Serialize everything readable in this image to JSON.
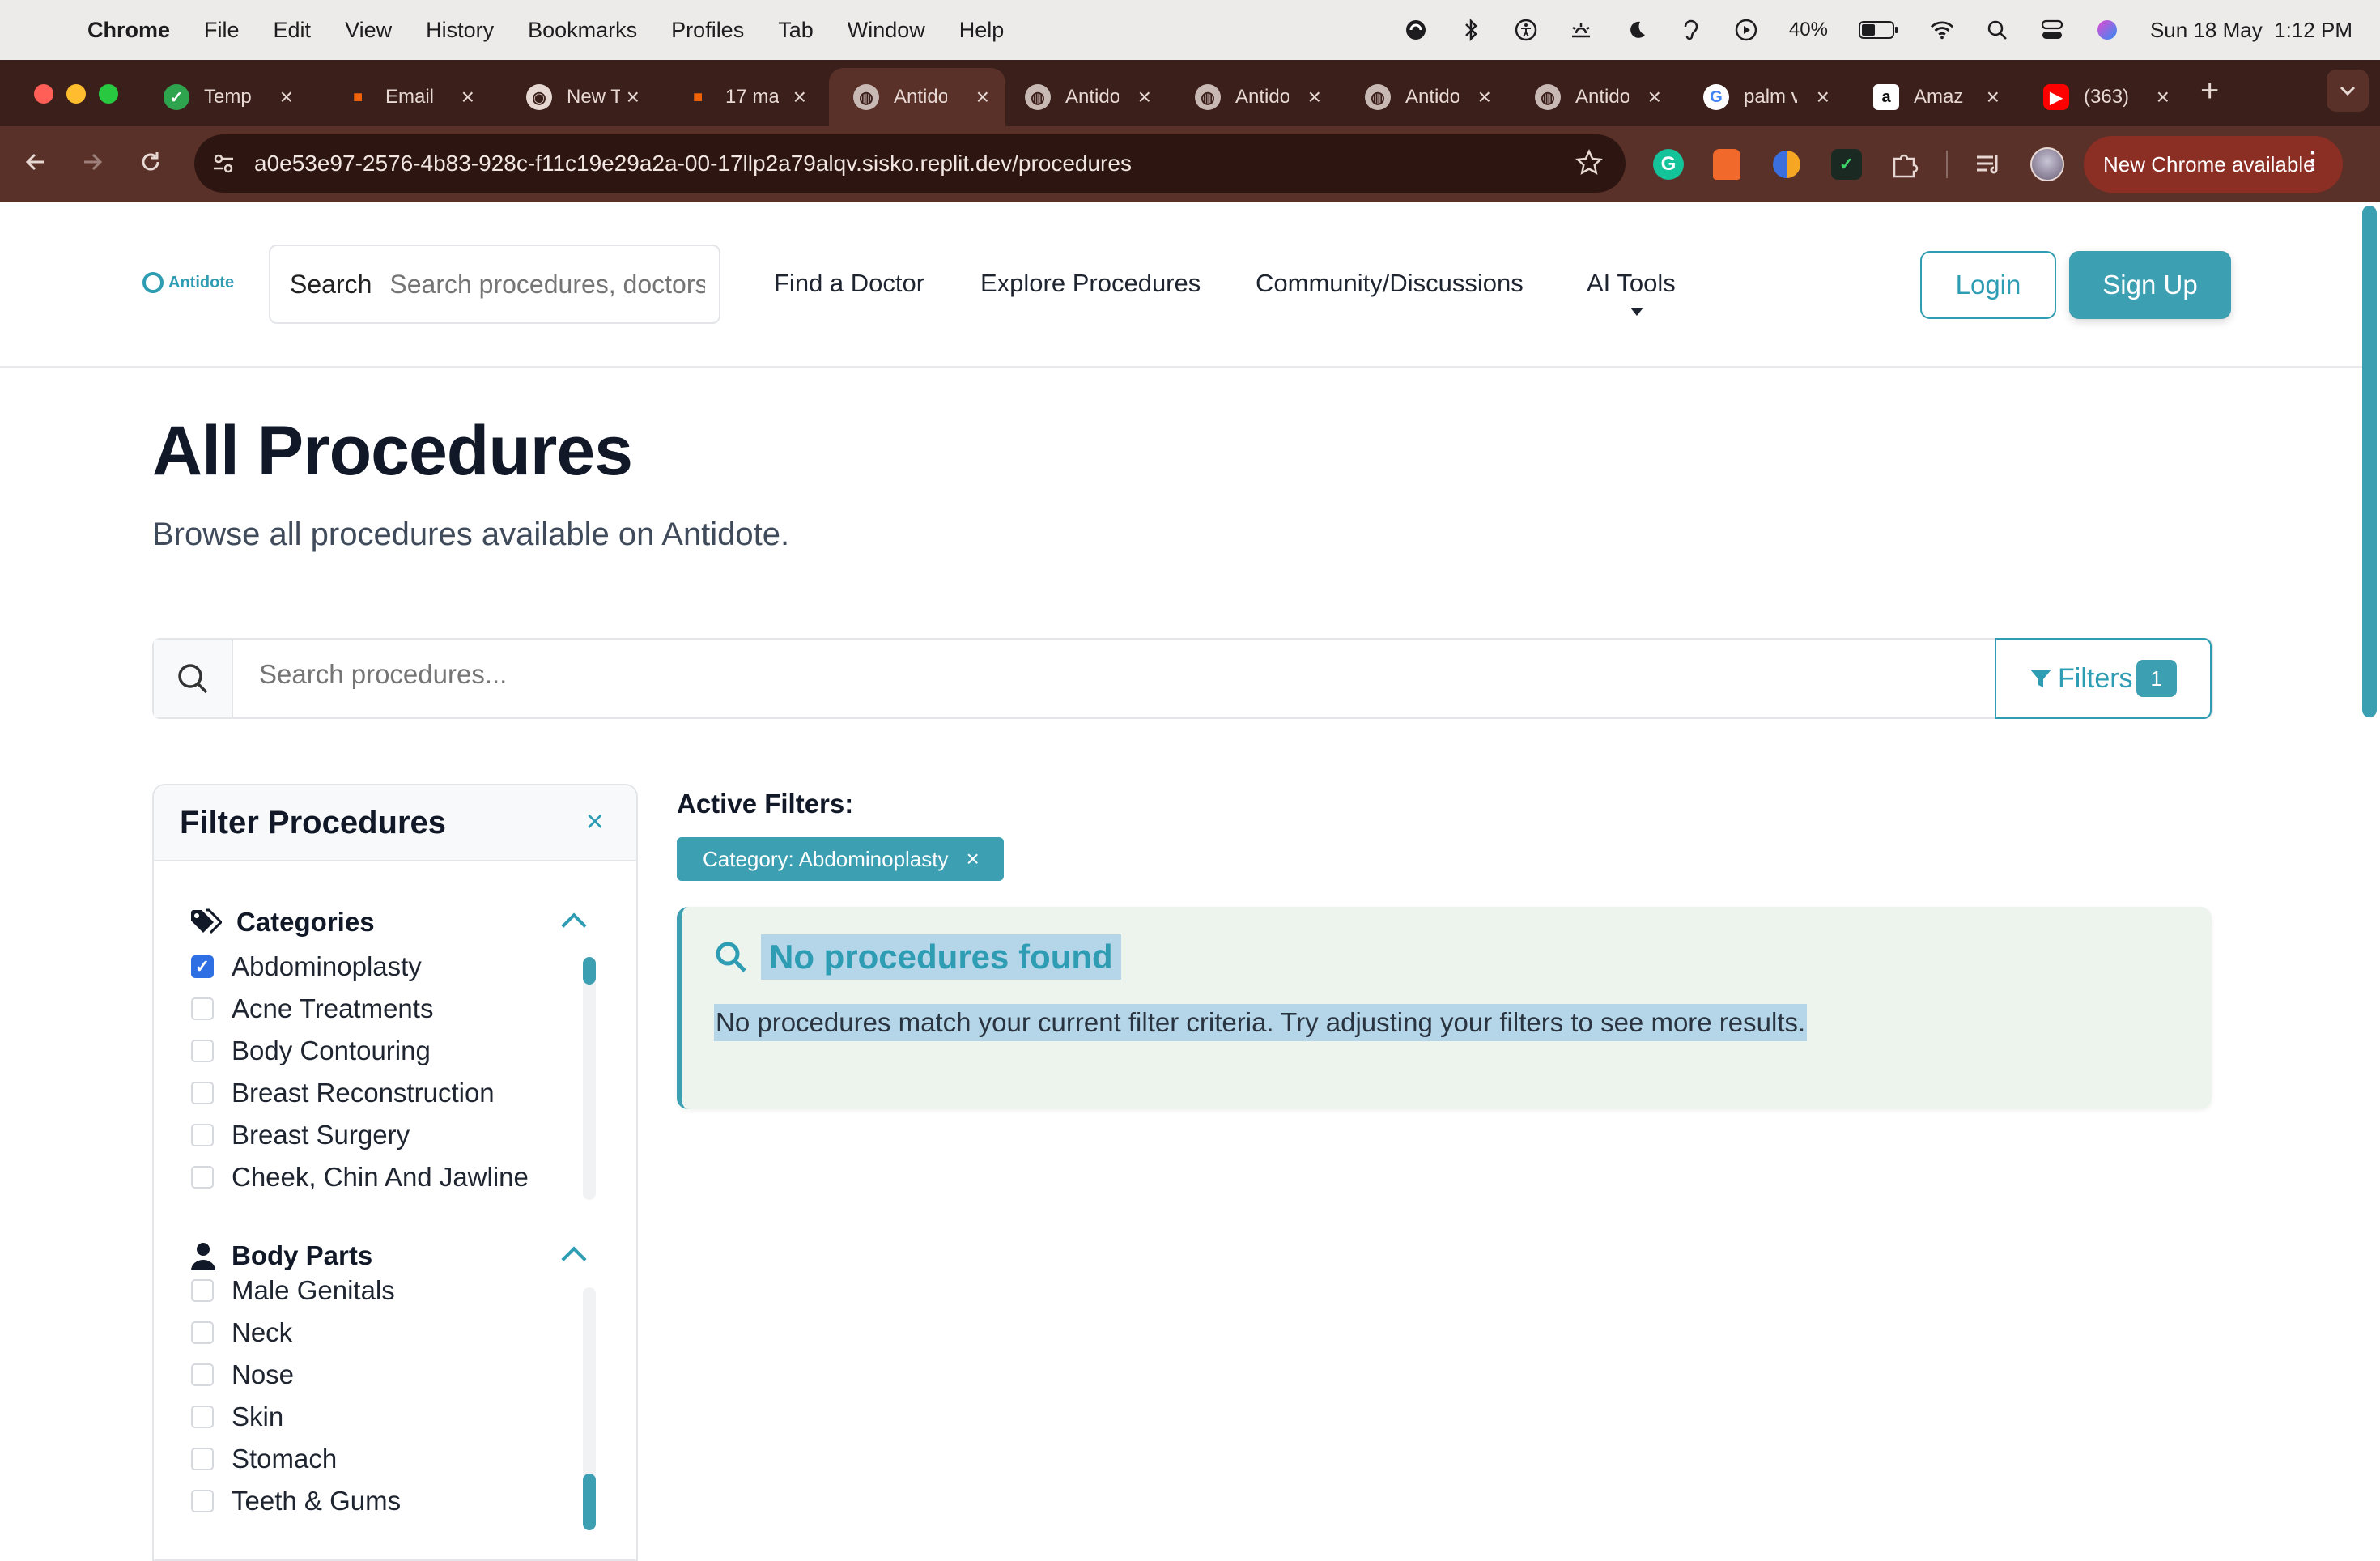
{
  "menubar": {
    "app": "Chrome",
    "items": [
      "File",
      "Edit",
      "View",
      "History",
      "Bookmarks",
      "Profiles",
      "Tab",
      "Window",
      "Help"
    ],
    "battery": "40%",
    "datetime": "Sun 18 May  1:12 PM"
  },
  "tabs": [
    {
      "title": "Temp",
      "icon": "shield-icon"
    },
    {
      "title": "Email",
      "icon": "replit-icon"
    },
    {
      "title": "New T",
      "icon": "chrome-icon"
    },
    {
      "title": "17 ma",
      "icon": "replit-icon"
    },
    {
      "title": "Antido",
      "icon": "globe-icon"
    },
    {
      "title": "Antido",
      "icon": "globe-icon"
    },
    {
      "title": "Antido",
      "icon": "globe-icon"
    },
    {
      "title": "Antido",
      "icon": "globe-icon"
    },
    {
      "title": "Antido",
      "icon": "globe-icon"
    },
    {
      "title": "palm v",
      "icon": "google-icon"
    },
    {
      "title": "Amaz",
      "icon": "amazon-icon"
    },
    {
      "title": "(363)",
      "icon": "youtube-icon"
    }
  ],
  "active_tab": 4,
  "toolbar": {
    "url": "a0e53e97-2576-4b83-928c-f11c19e29a2a-00-17llp2a79alqv.sisko.replit.dev/procedures",
    "new_chrome": "New Chrome available"
  },
  "header": {
    "logo": "Antidote",
    "search_label": "Search",
    "search_placeholder": "Search procedures, doctors",
    "nav": [
      "Find a Doctor",
      "Explore Procedures",
      "Community/Discussions",
      "AI Tools"
    ],
    "login": "Login",
    "signup": "Sign Up"
  },
  "main": {
    "title": "All Procedures",
    "subtitle": "Browse all procedures available on Antidote.",
    "search_placeholder": "Search procedures...",
    "filters_label": "Filters",
    "filters_count": "1"
  },
  "filter_panel": {
    "title": "Filter Procedures",
    "close": "×",
    "categories": {
      "label": "Categories",
      "options": [
        {
          "label": "Abdominoplasty",
          "checked": true
        },
        {
          "label": "Acne Treatments",
          "checked": false
        },
        {
          "label": "Body Contouring",
          "checked": false
        },
        {
          "label": "Breast Reconstruction",
          "checked": false
        },
        {
          "label": "Breast Surgery",
          "checked": false
        },
        {
          "label": "Cheek, Chin And Jawline",
          "checked": false
        }
      ]
    },
    "body_parts": {
      "label": "Body Parts",
      "options": [
        {
          "label": "Male Genitals",
          "checked": false
        },
        {
          "label": "Neck",
          "checked": false
        },
        {
          "label": "Nose",
          "checked": false
        },
        {
          "label": "Skin",
          "checked": false
        },
        {
          "label": "Stomach",
          "checked": false
        },
        {
          "label": "Teeth & Gums",
          "checked": false
        }
      ]
    }
  },
  "results": {
    "active_filters_label": "Active Filters:",
    "chip": "Category: Abdominoplasty",
    "empty_title": "No procedures found",
    "empty_message": "No procedures match your current filter criteria. Try adjusting your filters to see more results."
  },
  "colors": {
    "accent": "#3d9fb2",
    "tab_bar": "#3b1f1a",
    "toolbar": "#5a3129"
  }
}
